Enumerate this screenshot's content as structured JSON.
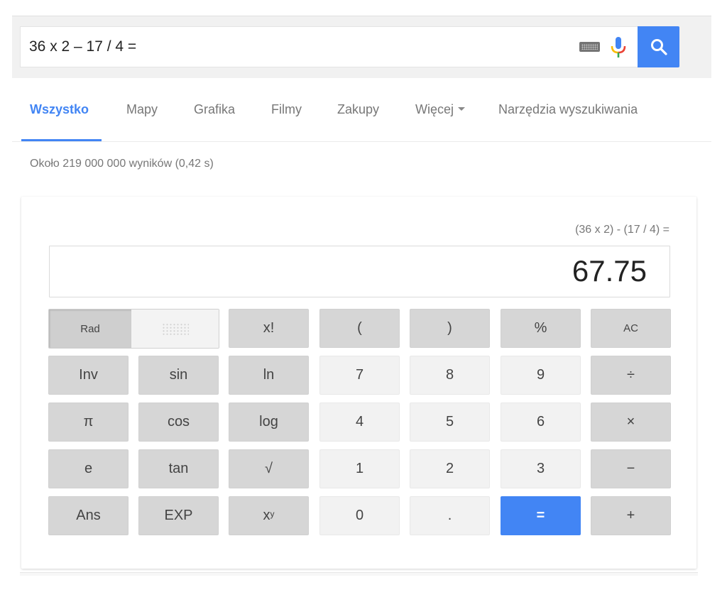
{
  "search": {
    "query": "36 x 2 – 17 / 4 =",
    "keyboard_icon": "keyboard-icon",
    "mic_icon": "microphone-icon",
    "search_icon": "magnifier-icon",
    "accent_color": "#4285f4"
  },
  "tabs": [
    {
      "label": "Wszystko",
      "active": true
    },
    {
      "label": "Mapy",
      "active": false
    },
    {
      "label": "Grafika",
      "active": false
    },
    {
      "label": "Filmy",
      "active": false
    },
    {
      "label": "Zakupy",
      "active": false
    },
    {
      "label": "Więcej",
      "active": false,
      "has_dropdown": true
    },
    {
      "label": "Narzędzia wyszukiwania",
      "active": false
    }
  ],
  "results_count": "Około 219 000 000 wyników (0,42 s)",
  "calculator": {
    "expression": "(36 x 2) - (17 / 4) =",
    "result": "67.75",
    "mode_toggle": {
      "selected": "Rad",
      "other_label_obscured": true,
      "rad_label": "Rad"
    },
    "keys": {
      "factorial": "x!",
      "open_paren": "(",
      "close_paren": ")",
      "percent": "%",
      "clear": "AC",
      "inv": "Inv",
      "sin": "sin",
      "ln": "ln",
      "seven": "7",
      "eight": "8",
      "nine": "9",
      "divide": "÷",
      "pi": "π",
      "cos": "cos",
      "log": "log",
      "four": "4",
      "five": "5",
      "six": "6",
      "multiply": "×",
      "e": "e",
      "tan": "tan",
      "sqrt": "√",
      "one": "1",
      "two": "2",
      "three": "3",
      "minus": "−",
      "ans": "Ans",
      "exp": "EXP",
      "power_base": "x",
      "power_exp": "y",
      "zero": "0",
      "decimal": ".",
      "equals": "=",
      "plus": "+"
    }
  }
}
